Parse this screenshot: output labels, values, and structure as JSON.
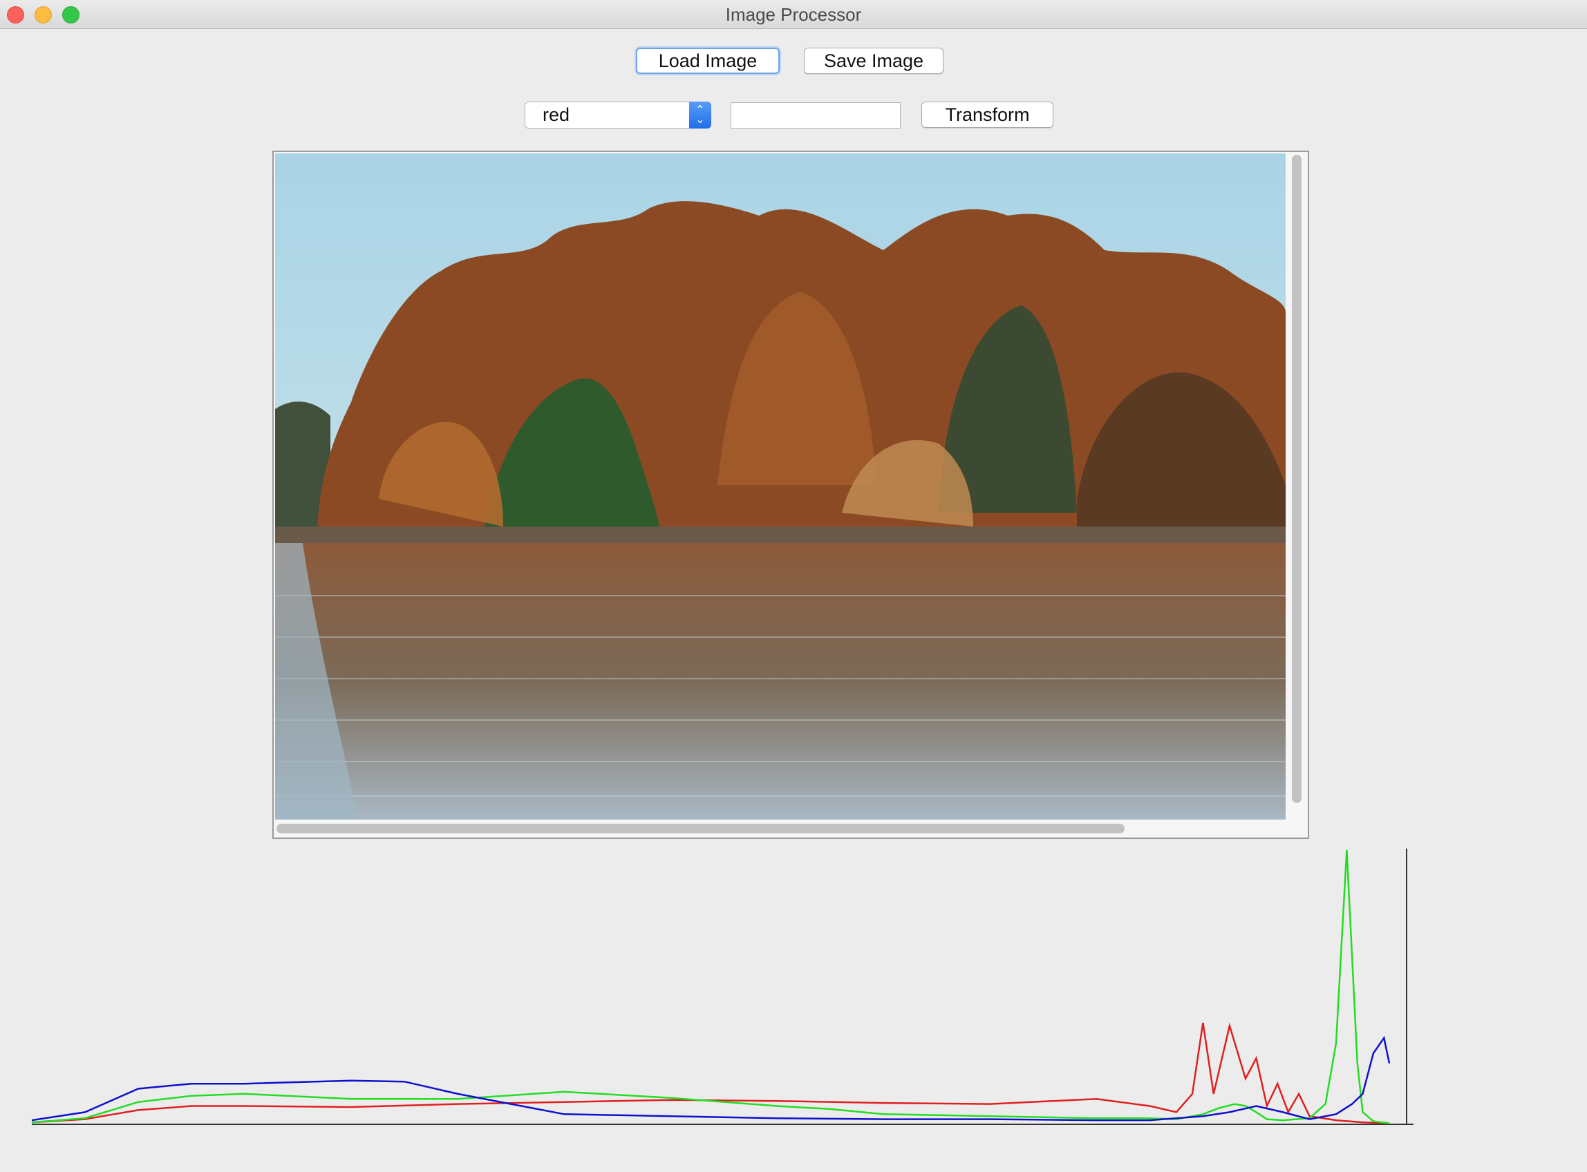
{
  "window": {
    "title": "Image Processor"
  },
  "toolbar": {
    "load_label": "Load Image",
    "save_label": "Save Image",
    "transform_label": "Transform"
  },
  "channel_select": {
    "value": "red"
  },
  "transform_input": {
    "value": ""
  },
  "viewer": {
    "image_description": "autumn trees on a shoreline reflected in a lake"
  },
  "histogram": {
    "colors": {
      "red": "#e02020",
      "green": "#22dd22",
      "blue": "#1010cc",
      "axis": "#333333"
    }
  },
  "chart_data": {
    "type": "line",
    "title": "",
    "xlabel": "",
    "ylabel": "",
    "xlim": [
      0,
      255
    ],
    "grid": false,
    "series": [
      {
        "color": "red",
        "x": [
          0,
          10,
          20,
          30,
          40,
          60,
          80,
          100,
          120,
          140,
          160,
          180,
          200,
          210,
          215,
          218,
          220,
          222,
          225,
          228,
          230,
          232,
          234,
          236,
          238,
          240,
          245,
          250,
          255
        ],
        "y": [
          2,
          5,
          14,
          18,
          18,
          17,
          20,
          22,
          24,
          23,
          21,
          20,
          25,
          18,
          12,
          30,
          100,
          30,
          97,
          45,
          65,
          18,
          40,
          12,
          30,
          8,
          4,
          2,
          1
        ]
      },
      {
        "color": "green",
        "x": [
          0,
          10,
          20,
          30,
          40,
          60,
          80,
          100,
          120,
          140,
          150,
          160,
          180,
          200,
          210,
          215,
          220,
          223,
          226,
          228,
          230,
          232,
          235,
          240,
          243,
          245,
          247,
          249,
          250,
          252,
          255
        ],
        "y": [
          2,
          6,
          22,
          28,
          30,
          25,
          25,
          32,
          26,
          18,
          15,
          10,
          8,
          6,
          6,
          5,
          10,
          16,
          20,
          18,
          12,
          5,
          4,
          6,
          20,
          80,
          270,
          60,
          12,
          3,
          1
        ]
      },
      {
        "color": "blue",
        "x": [
          0,
          10,
          20,
          30,
          40,
          60,
          70,
          80,
          90,
          100,
          120,
          140,
          160,
          180,
          200,
          210,
          220,
          225,
          230,
          235,
          240,
          245,
          248,
          250,
          252,
          254,
          255
        ],
        "y": [
          4,
          12,
          35,
          40,
          40,
          43,
          42,
          30,
          20,
          10,
          8,
          6,
          5,
          5,
          4,
          4,
          8,
          12,
          18,
          12,
          5,
          10,
          20,
          30,
          70,
          85,
          60
        ]
      }
    ]
  }
}
